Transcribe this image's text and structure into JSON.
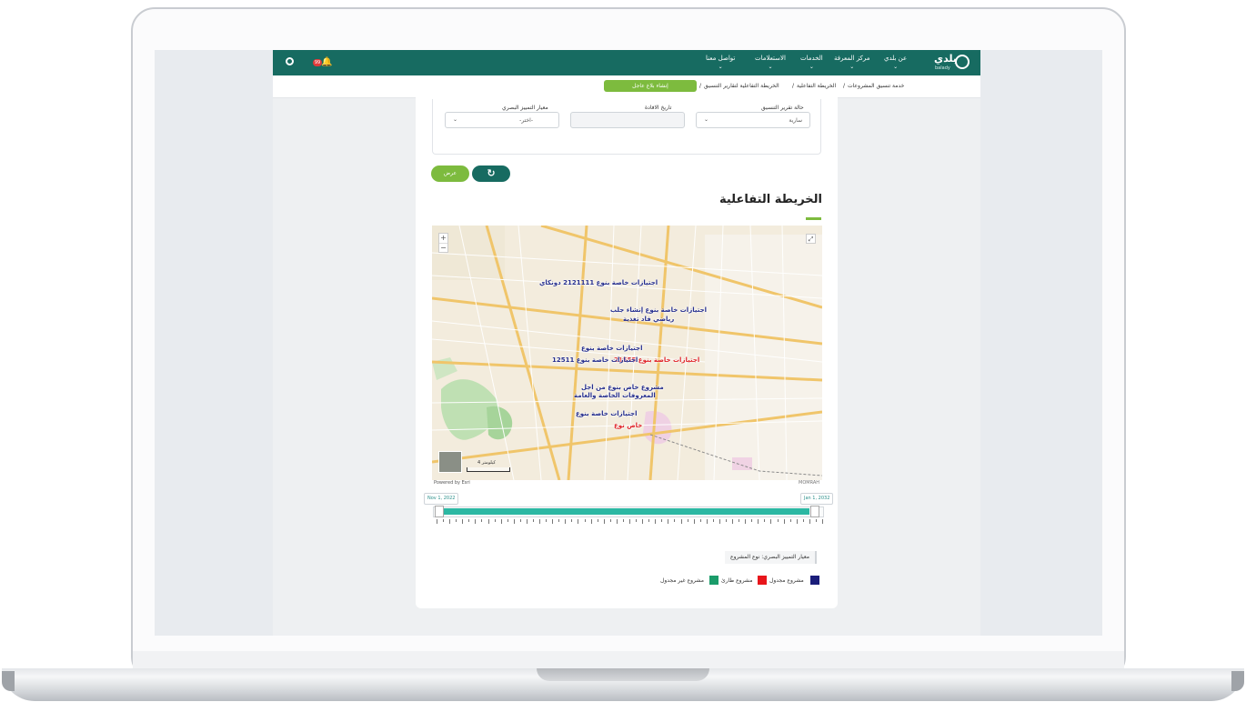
{
  "nav": {
    "brand": "بلدي",
    "brand_sub": "balady",
    "items": [
      "عن بلدي",
      "مركز المعرفة",
      "الخدمات",
      "الاستعلامات",
      "تواصل معنا"
    ],
    "notification_badge": "99"
  },
  "breadcrumb": {
    "items": [
      "خدمة تنسيق المشروعات",
      "الخريطة التفاعلية",
      "الخريطة التفاعلية لتقارير التنسيق"
    ],
    "report_button": "إنشاء بلاغ عاجل"
  },
  "filters": {
    "status_label": "حالة تقرير التنسيق",
    "status_value": "سارية",
    "date_label": "تاريخ الافادة",
    "criteria_label": "معيار التمييز البصري",
    "criteria_value": "-اختر-"
  },
  "actions": {
    "show": "عرض"
  },
  "section_title": "الخريطة التفاعلية",
  "map": {
    "powered_by": "Powered by Esri",
    "scale": "4 كيلومتر",
    "attribution": "MOMRAH",
    "labels": [
      {
        "text": "اجتيازات خاصة بنوع 2121111 دونكاي",
        "tone": "blue"
      },
      {
        "text": "اجتيازات خاصة بنوع إنشاء جلب",
        "tone": "blue"
      },
      {
        "text": "رياضي فاد تغذية",
        "tone": "blue"
      },
      {
        "text": "اجتيازات خاصة بنوع",
        "tone": "blue"
      },
      {
        "text": "اجتيازات خاصة بنوع 21555",
        "tone": "red"
      },
      {
        "text": "اجتيازات خاصة بنوع 12511",
        "tone": "blue"
      },
      {
        "text": "مشروع خاص بنوع من اجل",
        "tone": "blue"
      },
      {
        "text": "المعروفات الخاصة والعامة",
        "tone": "blue"
      },
      {
        "text": "اجتيازات خاصة بنوع",
        "tone": "blue"
      },
      {
        "text": "خاص نوع",
        "tone": "red"
      }
    ]
  },
  "timeline": {
    "start": "Nov 1, 2022",
    "end": "Jan 1, 2032"
  },
  "criteria_caption": "معيار التمييز البصري: نوع المشروع",
  "legend": [
    {
      "label": "مشروع مجدول",
      "color": "#1a1d7a"
    },
    {
      "label": "مشروع طارئ",
      "color": "#e8151b"
    },
    {
      "label": "مشروع غير مجدول",
      "color": "#1a9c6a"
    }
  ]
}
